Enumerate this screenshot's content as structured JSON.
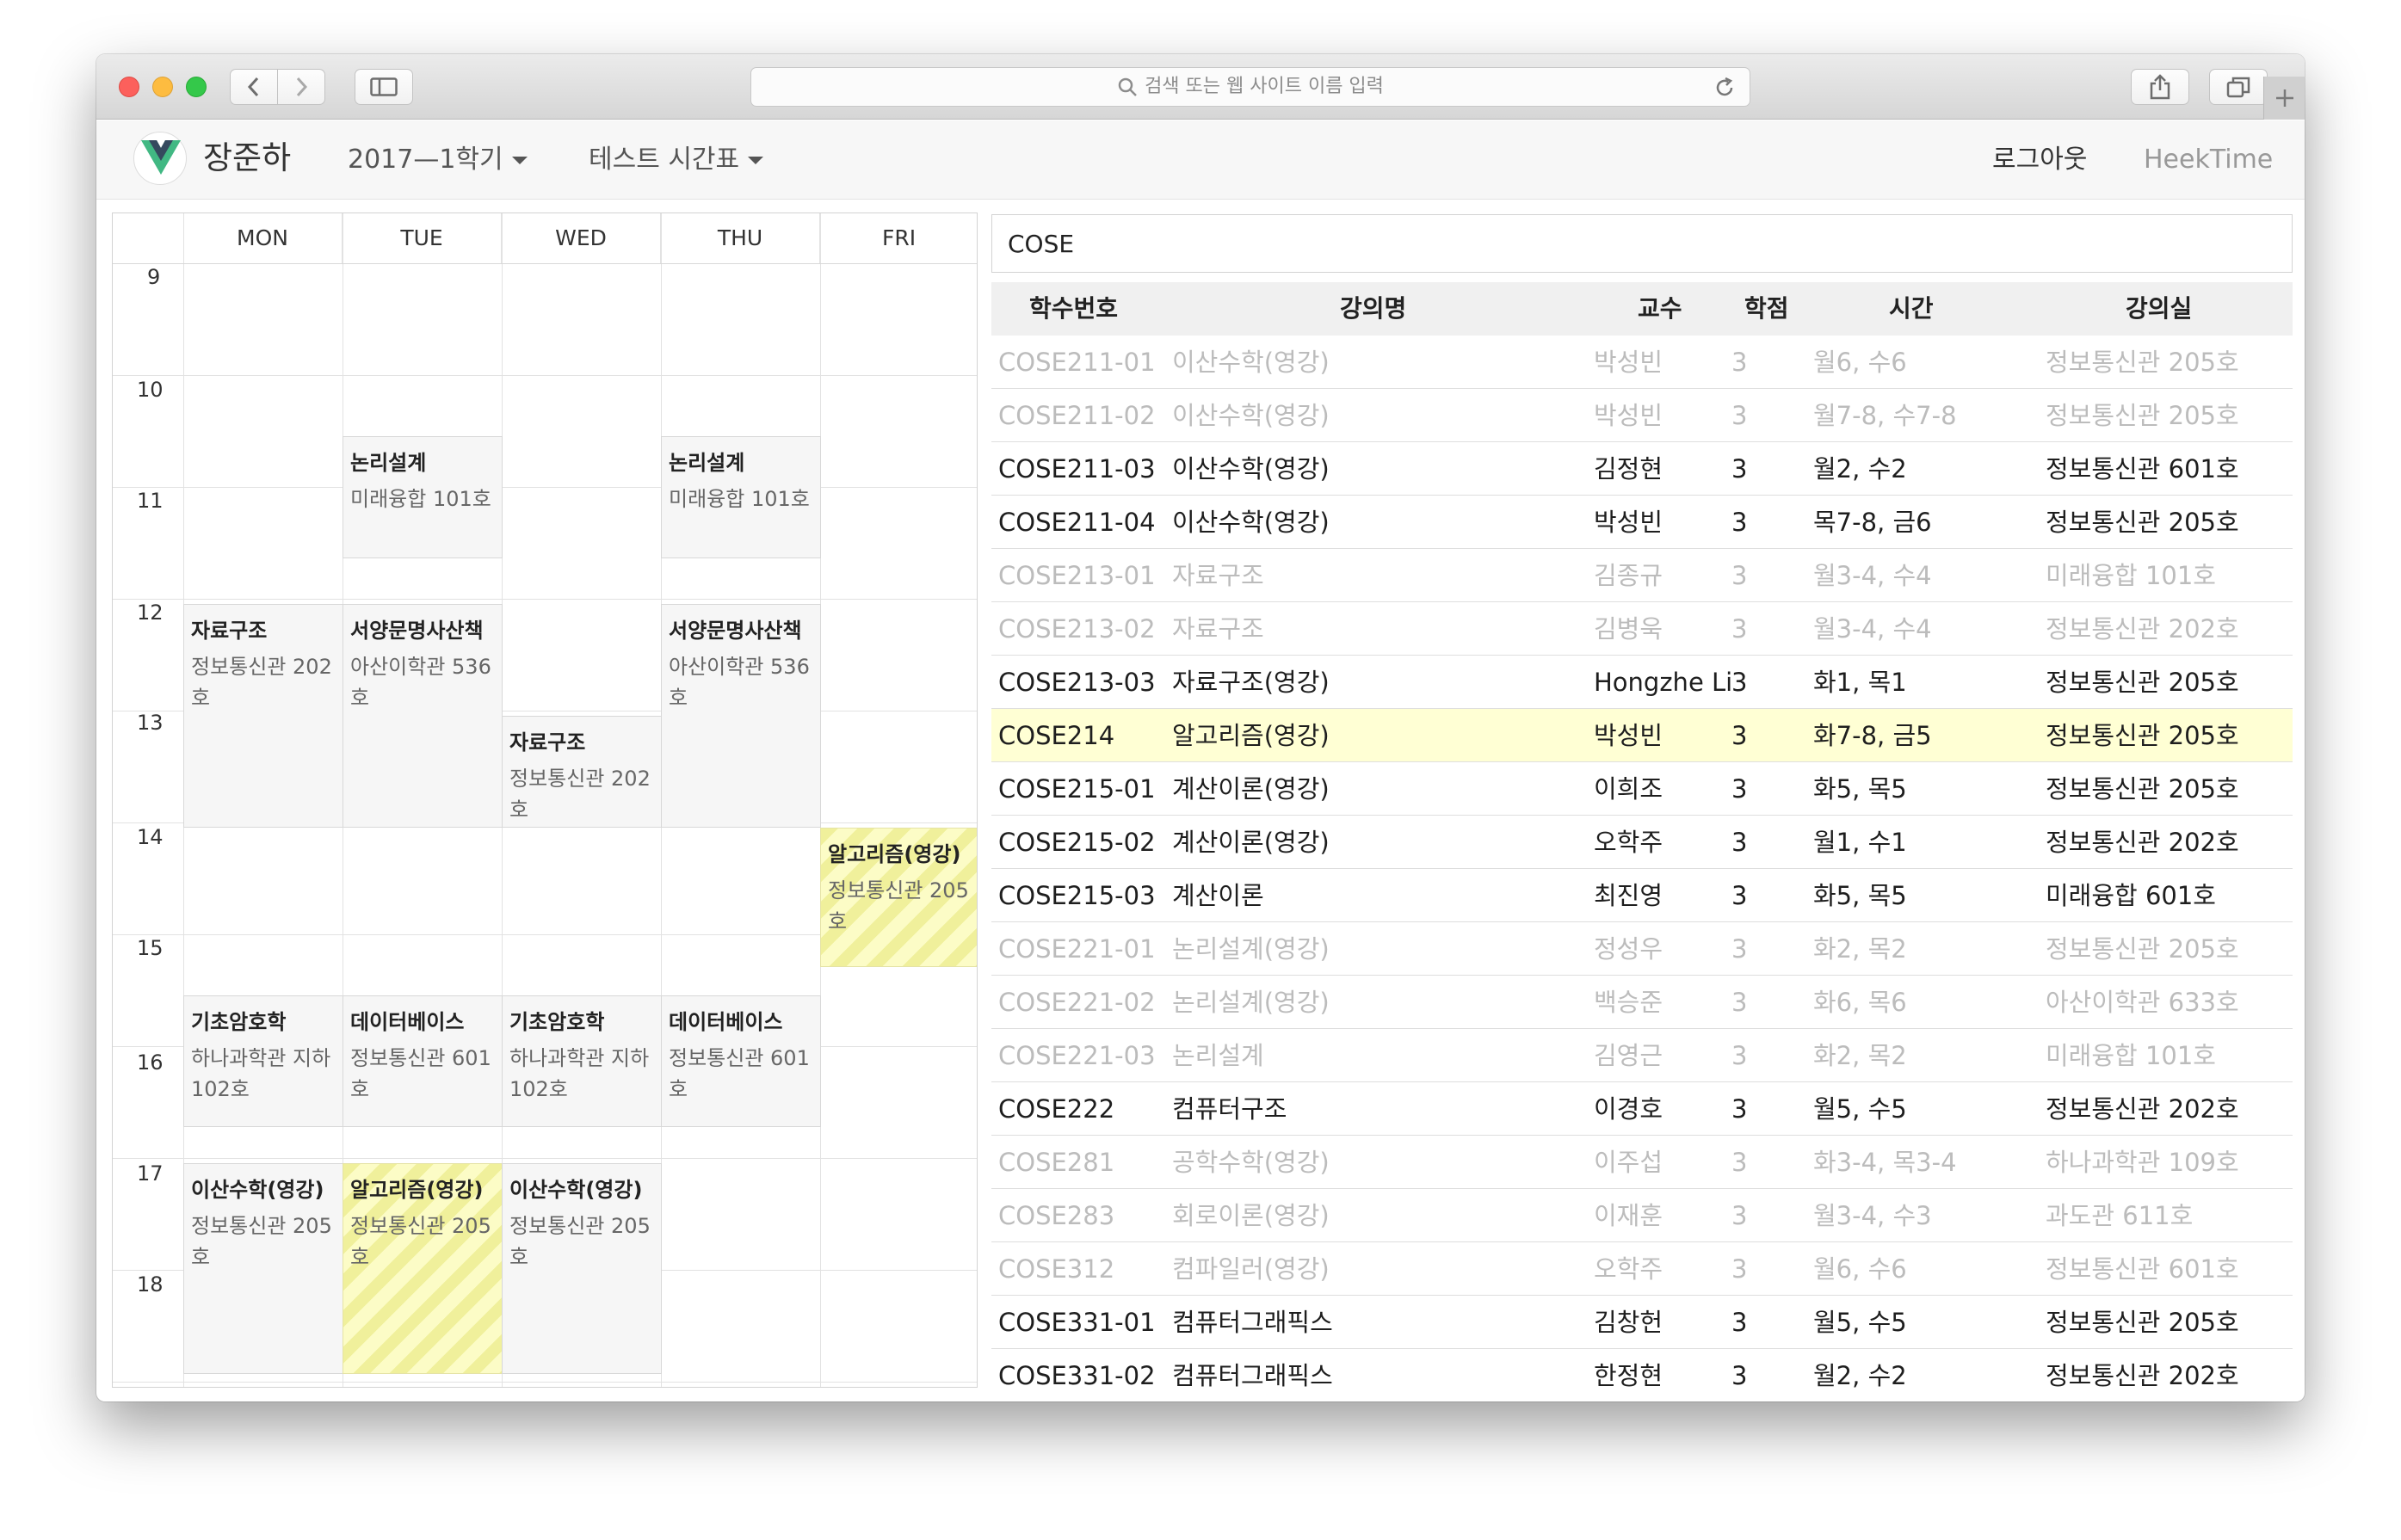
{
  "browser": {
    "url_placeholder": "검색 또는 웹 사이트 이름 입력"
  },
  "header": {
    "user_name": "장준하",
    "semester": "2017—1학기",
    "timetable_name": "테스트 시간표",
    "logout": "로그아웃",
    "brand": "HeekTime"
  },
  "timetable": {
    "days": [
      "MON",
      "TUE",
      "WED",
      "THU",
      "FRI"
    ],
    "hours": [
      "9",
      "10",
      "11",
      "12",
      "13",
      "14",
      "15",
      "16",
      "17",
      "18"
    ],
    "blocks": [
      {
        "title": "논리설계",
        "room": "미래융합 101호",
        "highlight": false
      },
      {
        "title": "논리설계",
        "room": "미래융합 101호",
        "highlight": false
      },
      {
        "title": "자료구조",
        "room": "정보통신관 202호",
        "highlight": false
      },
      {
        "title": "서양문명사산책",
        "room": "아산이학관 536호",
        "highlight": false
      },
      {
        "title": "서양문명사산책",
        "room": "아산이학관 536호",
        "highlight": false
      },
      {
        "title": "자료구조",
        "room": "정보통신관 202호",
        "highlight": false
      },
      {
        "title": "알고리즘(영강)",
        "room": "정보통신관 205호",
        "highlight": true
      },
      {
        "title": "기초암호학",
        "room": "하나과학관 지하102호",
        "highlight": false
      },
      {
        "title": "데이터베이스",
        "room": "정보통신관 601호",
        "highlight": false
      },
      {
        "title": "기초암호학",
        "room": "하나과학관 지하102호",
        "highlight": false
      },
      {
        "title": "데이터베이스",
        "room": "정보통신관 601호",
        "highlight": false
      },
      {
        "title": "이산수학(영강)",
        "room": "정보통신관 205호",
        "highlight": false
      },
      {
        "title": "알고리즘(영강)",
        "room": "정보통신관 205호",
        "highlight": true
      },
      {
        "title": "이산수학(영강)",
        "room": "정보통신관 205호",
        "highlight": false
      }
    ]
  },
  "course_list": {
    "search_value": "COSE",
    "columns": {
      "code": "학수번호",
      "name": "강의명",
      "professor": "교수",
      "credits": "학점",
      "time": "시간",
      "room": "강의실"
    },
    "rows": [
      {
        "code": "COSE211-01",
        "name": "이산수학(영강)",
        "professor": "박성빈",
        "credits": "3",
        "time": "월6, 수6",
        "room": "정보통신관 205호",
        "state": "disabled"
      },
      {
        "code": "COSE211-02",
        "name": "이산수학(영강)",
        "professor": "박성빈",
        "credits": "3",
        "time": "월7-8, 수7-8",
        "room": "정보통신관 205호",
        "state": "disabled"
      },
      {
        "code": "COSE211-03",
        "name": "이산수학(영강)",
        "professor": "김정현",
        "credits": "3",
        "time": "월2, 수2",
        "room": "정보통신관 601호",
        "state": "enabled"
      },
      {
        "code": "COSE211-04",
        "name": "이산수학(영강)",
        "professor": "박성빈",
        "credits": "3",
        "time": "목7-8, 금6",
        "room": "정보통신관 205호",
        "state": "enabled"
      },
      {
        "code": "COSE213-01",
        "name": "자료구조",
        "professor": "김종규",
        "credits": "3",
        "time": "월3-4, 수4",
        "room": "미래융합 101호",
        "state": "disabled"
      },
      {
        "code": "COSE213-02",
        "name": "자료구조",
        "professor": "김병욱",
        "credits": "3",
        "time": "월3-4, 수4",
        "room": "정보통신관 202호",
        "state": "disabled"
      },
      {
        "code": "COSE213-03",
        "name": "자료구조(영강)",
        "professor": "Hongzhe Li",
        "credits": "3",
        "time": "화1, 목1",
        "room": "정보통신관 205호",
        "state": "enabled"
      },
      {
        "code": "COSE214",
        "name": "알고리즘(영강)",
        "professor": "박성빈",
        "credits": "3",
        "time": "화7-8, 금5",
        "room": "정보통신관 205호",
        "state": "selected"
      },
      {
        "code": "COSE215-01",
        "name": "계산이론(영강)",
        "professor": "이희조",
        "credits": "3",
        "time": "화5, 목5",
        "room": "정보통신관 205호",
        "state": "enabled"
      },
      {
        "code": "COSE215-02",
        "name": "계산이론(영강)",
        "professor": "오학주",
        "credits": "3",
        "time": "월1, 수1",
        "room": "정보통신관 202호",
        "state": "enabled"
      },
      {
        "code": "COSE215-03",
        "name": "계산이론",
        "professor": "최진영",
        "credits": "3",
        "time": "화5, 목5",
        "room": "미래융합 601호",
        "state": "enabled"
      },
      {
        "code": "COSE221-01",
        "name": "논리설계(영강)",
        "professor": "정성우",
        "credits": "3",
        "time": "화2, 목2",
        "room": "정보통신관 205호",
        "state": "disabled"
      },
      {
        "code": "COSE221-02",
        "name": "논리설계(영강)",
        "professor": "백승준",
        "credits": "3",
        "time": "화6, 목6",
        "room": "아산이학관 633호",
        "state": "disabled"
      },
      {
        "code": "COSE221-03",
        "name": "논리설계",
        "professor": "김영근",
        "credits": "3",
        "time": "화2, 목2",
        "room": "미래융합 101호",
        "state": "disabled"
      },
      {
        "code": "COSE222",
        "name": "컴퓨터구조",
        "professor": "이경호",
        "credits": "3",
        "time": "월5, 수5",
        "room": "정보통신관 202호",
        "state": "enabled"
      },
      {
        "code": "COSE281",
        "name": "공학수학(영강)",
        "professor": "이주섭",
        "credits": "3",
        "time": "화3-4, 목3-4",
        "room": "하나과학관 109호",
        "state": "disabled"
      },
      {
        "code": "COSE283",
        "name": "회로이론(영강)",
        "professor": "이재훈",
        "credits": "3",
        "time": "월3-4, 수3",
        "room": "과도관 611호",
        "state": "disabled"
      },
      {
        "code": "COSE312",
        "name": "컴파일러(영강)",
        "professor": "오학주",
        "credits": "3",
        "time": "월6, 수6",
        "room": "정보통신관 601호",
        "state": "disabled"
      },
      {
        "code": "COSE331-01",
        "name": "컴퓨터그래픽스",
        "professor": "김창헌",
        "credits": "3",
        "time": "월5, 수5",
        "room": "정보통신관 205호",
        "state": "enabled"
      },
      {
        "code": "COSE331-02",
        "name": "컴퓨터그래픽스",
        "professor": "한정현",
        "credits": "3",
        "time": "월2, 수2",
        "room": "정보통신관 202호",
        "state": "enabled"
      }
    ]
  }
}
